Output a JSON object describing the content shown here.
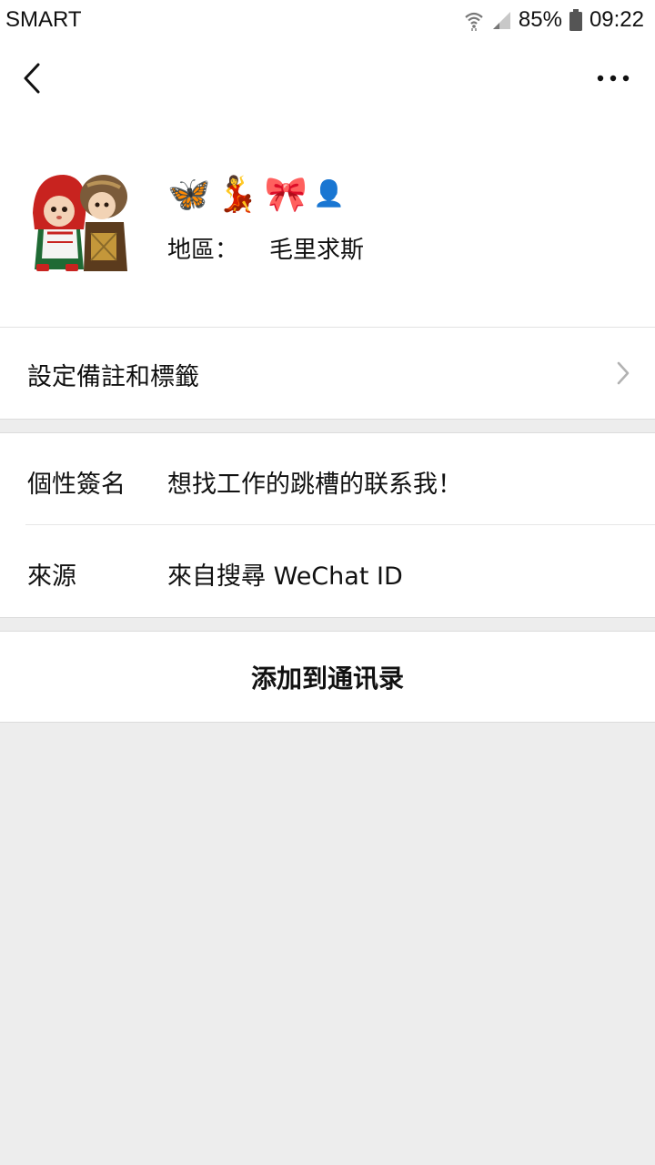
{
  "status_bar": {
    "carrier": "SMART",
    "battery_percent": "85%",
    "time": "09:22"
  },
  "nav": {
    "back_icon": "chevron-left-icon",
    "more_icon": "more-dots-icon"
  },
  "profile": {
    "nickname_emojis": [
      "🦋",
      "💃",
      "🎀",
      "👤"
    ],
    "region_label": "地區：",
    "region_value": "毛里求斯"
  },
  "remark_row": {
    "label": "設定備註和標籤"
  },
  "info": {
    "signature_label": "個性簽名",
    "signature_value": "想找工作的跳槽的联系我！",
    "source_label": "來源",
    "source_value": "來自搜尋 WeChat ID"
  },
  "actions": {
    "add_contact": "添加到通讯录"
  },
  "colors": {
    "page_bg": "#ededed",
    "card_bg": "#ffffff",
    "text": "#111111",
    "chevron": "#b2b2b2"
  }
}
